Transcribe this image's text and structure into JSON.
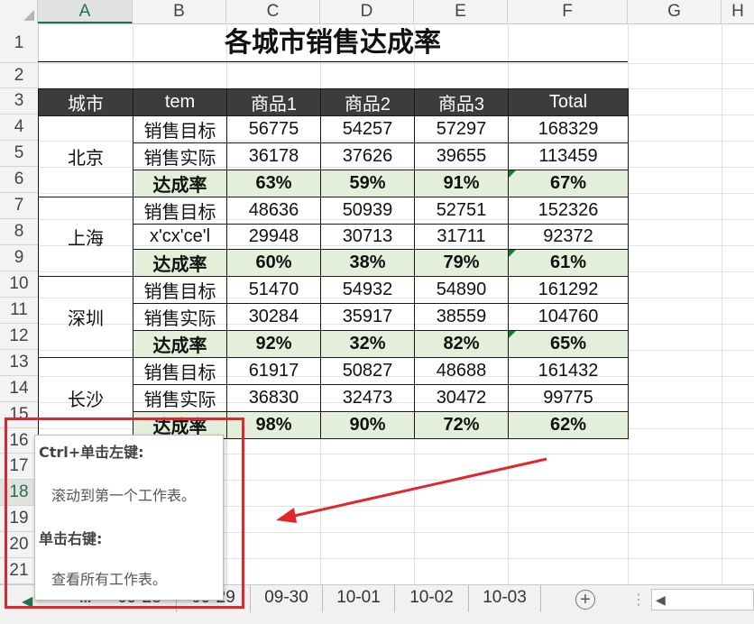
{
  "columns": [
    "A",
    "B",
    "C",
    "D",
    "E",
    "F",
    "G",
    "H"
  ],
  "selected_column": "A",
  "rows": [
    "1",
    "2",
    "3",
    "4",
    "5",
    "6",
    "7",
    "8",
    "9",
    "10",
    "11",
    "12",
    "13",
    "14",
    "15",
    "16",
    "17",
    "18",
    "19",
    "20",
    "21"
  ],
  "selected_row": "18",
  "title": "各城市销售达成率",
  "table": {
    "headers": [
      "城市",
      "tem",
      "商品1",
      "商品2",
      "商品3",
      "Total"
    ],
    "groups": [
      {
        "city": "北京",
        "rows": [
          {
            "label": "销售目标",
            "v1": "56775",
            "v2": "54257",
            "v3": "57297",
            "total": "168329"
          },
          {
            "label": "销售实际",
            "v1": "36178",
            "v2": "37626",
            "v3": "39655",
            "total": "113459"
          },
          {
            "label": "达成率",
            "v1": "63%",
            "v2": "59%",
            "v3": "91%",
            "total": "67%"
          }
        ]
      },
      {
        "city": "上海",
        "rows": [
          {
            "label": "销售目标",
            "v1": "48636",
            "v2": "50939",
            "v3": "52751",
            "total": "152326"
          },
          {
            "label": "x'cx'ce'l",
            "v1": "29948",
            "v2": "30713",
            "v3": "31711",
            "total": "92372"
          },
          {
            "label": "达成率",
            "v1": "60%",
            "v2": "38%",
            "v3": "79%",
            "total": "61%"
          }
        ]
      },
      {
        "city": "深圳",
        "rows": [
          {
            "label": "销售目标",
            "v1": "51470",
            "v2": "54932",
            "v3": "54890",
            "total": "161292"
          },
          {
            "label": "销售实际",
            "v1": "30284",
            "v2": "35917",
            "v3": "38559",
            "total": "104760"
          },
          {
            "label": "达成率",
            "v1": "92%",
            "v2": "32%",
            "v3": "82%",
            "total": "65%"
          }
        ]
      },
      {
        "city": "长沙",
        "rows": [
          {
            "label": "销售目标",
            "v1": "61917",
            "v2": "50827",
            "v3": "48688",
            "total": "161432"
          },
          {
            "label": "销售实际",
            "v1": "36830",
            "v2": "32473",
            "v3": "30472",
            "total": "99775"
          },
          {
            "label": "达成率",
            "v1": "98%",
            "v2": "90%",
            "v3": "72%",
            "total": "62%"
          }
        ]
      }
    ]
  },
  "tooltip": {
    "heading1": "Ctrl+单击左键:",
    "body1": "滚动到第一个工作表。",
    "heading2": "单击右键:",
    "body2": "查看所有工作表。"
  },
  "tabs": {
    "more": "...",
    "partial": [
      "09-28",
      "09-29"
    ],
    "items": [
      "09-30",
      "10-01",
      "10-02",
      "10-03"
    ]
  },
  "icons": {
    "prev": "triangle-left",
    "add": "plus-circle",
    "scroll_left": "triangle-left"
  },
  "colors": {
    "header_bg": "#3c3c3c",
    "rate_bg": "#e3efda",
    "excel_green": "#217346",
    "highlight": "#e3262c"
  }
}
